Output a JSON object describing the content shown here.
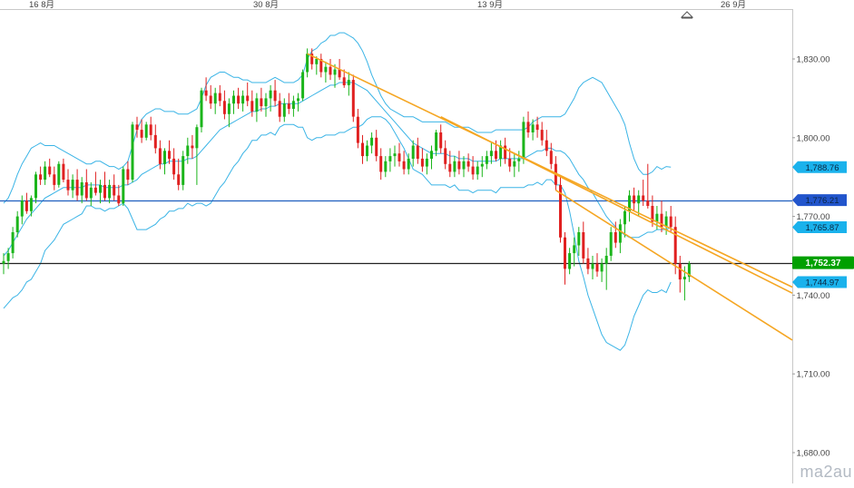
{
  "chart_data": {
    "type": "candlestick",
    "title": "",
    "x_ticks": [
      "16 8月",
      "30 8月",
      "13 9月",
      "26 9月"
    ],
    "y_ticks": [
      "1,830.00",
      "1,800.00",
      "1,770.00",
      "1,740.00",
      "1,710.00",
      "1,680.00"
    ],
    "ylim": [
      1675,
      1848
    ],
    "grid": false,
    "colors": {
      "up": "#1bb51b",
      "down": "#e02020",
      "bollinger": "#3ab4e6",
      "trendline": "#f5a623",
      "support": "#1f5fbf",
      "current": "#222222",
      "price_tag_up": "#00a000",
      "price_tag_band": "#1ab2ec",
      "price_tag_support": "#2255cc"
    },
    "price_tags": [
      {
        "name": "upper-band",
        "label": "1,788.76",
        "value": 1788.76
      },
      {
        "name": "support-level",
        "label": "1,776.21",
        "value": 1776.21
      },
      {
        "name": "middle-band",
        "label": "1,765.87",
        "value": 1765.87
      },
      {
        "name": "current-price",
        "label": "1,752.37",
        "value": 1752.37
      },
      {
        "name": "lower-band",
        "label": "1,744.97",
        "value": 1744.97
      }
    ],
    "horizontal_lines": [
      {
        "name": "support-line",
        "value": 1776.21
      },
      {
        "name": "current-price-line",
        "value": 1752.37
      }
    ],
    "trendlines": [
      {
        "name": "trendline-upper",
        "from_index": 66,
        "from_value": 1832,
        "to_index": 130,
        "to_value": 1778
      },
      {
        "name": "trendline-mid",
        "from_index": 95,
        "from_value": 1808,
        "to_index": 145,
        "to_value": 1764
      },
      {
        "name": "trendline-lower",
        "from_index": 120,
        "from_value": 1780,
        "to_index": 147,
        "to_value": 1750
      }
    ],
    "candles_ohlc": [
      [
        1752,
        1756,
        1748,
        1753
      ],
      [
        1753,
        1758,
        1750,
        1756
      ],
      [
        1756,
        1766,
        1754,
        1764
      ],
      [
        1764,
        1772,
        1762,
        1770
      ],
      [
        1770,
        1778,
        1767,
        1776
      ],
      [
        1776,
        1779,
        1771,
        1772
      ],
      [
        1772,
        1778,
        1770,
        1777
      ],
      [
        1777,
        1787,
        1775,
        1786
      ],
      [
        1786,
        1789,
        1782,
        1784
      ],
      [
        1784,
        1791,
        1782,
        1789
      ],
      [
        1789,
        1792,
        1785,
        1786
      ],
      [
        1786,
        1789,
        1780,
        1782
      ],
      [
        1782,
        1791,
        1781,
        1790
      ],
      [
        1790,
        1792,
        1783,
        1784
      ],
      [
        1784,
        1788,
        1778,
        1780
      ],
      [
        1780,
        1786,
        1777,
        1784
      ],
      [
        1784,
        1788,
        1776,
        1778
      ],
      [
        1778,
        1785,
        1775,
        1783
      ],
      [
        1783,
        1788,
        1776,
        1777
      ],
      [
        1777,
        1783,
        1774,
        1781
      ],
      [
        1781,
        1787,
        1778,
        1779
      ],
      [
        1779,
        1784,
        1775,
        1782
      ],
      [
        1782,
        1787,
        1776,
        1777
      ],
      [
        1777,
        1784,
        1775,
        1782
      ],
      [
        1782,
        1786,
        1776,
        1778
      ],
      [
        1778,
        1782,
        1774,
        1775
      ],
      [
        1775,
        1789,
        1774,
        1788
      ],
      [
        1788,
        1791,
        1782,
        1784
      ],
      [
        1784,
        1806,
        1783,
        1805
      ],
      [
        1805,
        1808,
        1800,
        1803
      ],
      [
        1803,
        1807,
        1798,
        1800
      ],
      [
        1800,
        1806,
        1799,
        1805
      ],
      [
        1805,
        1808,
        1799,
        1801
      ],
      [
        1801,
        1805,
        1794,
        1796
      ],
      [
        1796,
        1799,
        1788,
        1790
      ],
      [
        1790,
        1796,
        1786,
        1795
      ],
      [
        1795,
        1799,
        1790,
        1792
      ],
      [
        1792,
        1796,
        1784,
        1786
      ],
      [
        1786,
        1792,
        1780,
        1782
      ],
      [
        1782,
        1795,
        1780,
        1793
      ],
      [
        1793,
        1800,
        1790,
        1797
      ],
      [
        1797,
        1801,
        1792,
        1796
      ],
      [
        1796,
        1805,
        1782,
        1804
      ],
      [
        1804,
        1819,
        1802,
        1818
      ],
      [
        1818,
        1823,
        1814,
        1816
      ],
      [
        1816,
        1820,
        1811,
        1813
      ],
      [
        1813,
        1819,
        1809,
        1817
      ],
      [
        1817,
        1820,
        1812,
        1814
      ],
      [
        1814,
        1818,
        1807,
        1809
      ],
      [
        1809,
        1815,
        1804,
        1813
      ],
      [
        1813,
        1818,
        1809,
        1816
      ],
      [
        1816,
        1819,
        1811,
        1813
      ],
      [
        1813,
        1818,
        1810,
        1816
      ],
      [
        1816,
        1821,
        1812,
        1814
      ],
      [
        1814,
        1818,
        1808,
        1810
      ],
      [
        1810,
        1817,
        1806,
        1815
      ],
      [
        1815,
        1819,
        1810,
        1812
      ],
      [
        1812,
        1817,
        1808,
        1815
      ],
      [
        1815,
        1820,
        1810,
        1818
      ],
      [
        1818,
        1822,
        1812,
        1814
      ],
      [
        1814,
        1817,
        1806,
        1808
      ],
      [
        1808,
        1815,
        1806,
        1813
      ],
      [
        1813,
        1817,
        1809,
        1811
      ],
      [
        1811,
        1816,
        1808,
        1814
      ],
      [
        1814,
        1817,
        1810,
        1815
      ],
      [
        1815,
        1826,
        1814,
        1825
      ],
      [
        1825,
        1834,
        1823,
        1832
      ],
      [
        1832,
        1834,
        1826,
        1828
      ],
      [
        1828,
        1831,
        1824,
        1830
      ],
      [
        1830,
        1832,
        1823,
        1825
      ],
      [
        1825,
        1829,
        1821,
        1827
      ],
      [
        1827,
        1830,
        1822,
        1824
      ],
      [
        1824,
        1828,
        1819,
        1826
      ],
      [
        1826,
        1830,
        1822,
        1823
      ],
      [
        1823,
        1826,
        1819,
        1820
      ],
      [
        1820,
        1825,
        1816,
        1822
      ],
      [
        1822,
        1824,
        1806,
        1808
      ],
      [
        1808,
        1811,
        1796,
        1798
      ],
      [
        1798,
        1801,
        1790,
        1793
      ],
      [
        1793,
        1799,
        1791,
        1797
      ],
      [
        1797,
        1802,
        1794,
        1800
      ],
      [
        1800,
        1803,
        1791,
        1793
      ],
      [
        1793,
        1796,
        1784,
        1787
      ],
      [
        1787,
        1793,
        1785,
        1791
      ],
      [
        1791,
        1796,
        1787,
        1793
      ],
      [
        1793,
        1797,
        1789,
        1794
      ],
      [
        1794,
        1798,
        1789,
        1791
      ],
      [
        1791,
        1795,
        1786,
        1788
      ],
      [
        1788,
        1794,
        1786,
        1792
      ],
      [
        1792,
        1799,
        1789,
        1797
      ],
      [
        1797,
        1800,
        1790,
        1792
      ],
      [
        1792,
        1796,
        1787,
        1789
      ],
      [
        1789,
        1794,
        1786,
        1792
      ],
      [
        1792,
        1797,
        1788,
        1795
      ],
      [
        1795,
        1803,
        1793,
        1802
      ],
      [
        1802,
        1805,
        1794,
        1796
      ],
      [
        1796,
        1799,
        1788,
        1790
      ],
      [
        1790,
        1795,
        1785,
        1787
      ],
      [
        1787,
        1793,
        1785,
        1791
      ],
      [
        1791,
        1795,
        1786,
        1788
      ],
      [
        1788,
        1793,
        1785,
        1791
      ],
      [
        1791,
        1794,
        1787,
        1789
      ],
      [
        1789,
        1793,
        1784,
        1786
      ],
      [
        1786,
        1791,
        1784,
        1789
      ],
      [
        1789,
        1793,
        1785,
        1790
      ],
      [
        1790,
        1795,
        1788,
        1793
      ],
      [
        1793,
        1798,
        1790,
        1795
      ],
      [
        1795,
        1799,
        1791,
        1792
      ],
      [
        1792,
        1799,
        1789,
        1797
      ],
      [
        1797,
        1800,
        1790,
        1792
      ],
      [
        1792,
        1796,
        1787,
        1789
      ],
      [
        1789,
        1794,
        1785,
        1791
      ],
      [
        1791,
        1795,
        1787,
        1792
      ],
      [
        1792,
        1808,
        1790,
        1806
      ],
      [
        1806,
        1810,
        1800,
        1802
      ],
      [
        1802,
        1807,
        1799,
        1805
      ],
      [
        1805,
        1808,
        1800,
        1803
      ],
      [
        1803,
        1806,
        1797,
        1799
      ],
      [
        1799,
        1803,
        1793,
        1795
      ],
      [
        1795,
        1798,
        1788,
        1790
      ],
      [
        1790,
        1793,
        1780,
        1782
      ],
      [
        1782,
        1785,
        1760,
        1762
      ],
      [
        1762,
        1764,
        1744,
        1750
      ],
      [
        1750,
        1758,
        1748,
        1756
      ],
      [
        1756,
        1762,
        1751,
        1759
      ],
      [
        1759,
        1766,
        1755,
        1764
      ],
      [
        1764,
        1768,
        1752,
        1754
      ],
      [
        1754,
        1758,
        1748,
        1750
      ],
      [
        1750,
        1755,
        1746,
        1752
      ],
      [
        1752,
        1756,
        1747,
        1749
      ],
      [
        1749,
        1754,
        1745,
        1752
      ],
      [
        1752,
        1758,
        1742,
        1755
      ],
      [
        1755,
        1766,
        1753,
        1764
      ],
      [
        1764,
        1768,
        1758,
        1760
      ],
      [
        1760,
        1769,
        1756,
        1767
      ],
      [
        1767,
        1774,
        1762,
        1772
      ],
      [
        1772,
        1780,
        1768,
        1778
      ],
      [
        1778,
        1781,
        1772,
        1775
      ],
      [
        1775,
        1780,
        1770,
        1778
      ],
      [
        1778,
        1784,
        1774,
        1776
      ],
      [
        1776,
        1790,
        1773,
        1774
      ],
      [
        1774,
        1778,
        1766,
        1768
      ],
      [
        1768,
        1774,
        1765,
        1771
      ],
      [
        1771,
        1776,
        1764,
        1766
      ],
      [
        1766,
        1772,
        1763,
        1770
      ],
      [
        1770,
        1774,
        1764,
        1766
      ],
      [
        1766,
        1770,
        1748,
        1752
      ],
      [
        1752,
        1755,
        1741,
        1746
      ],
      [
        1746,
        1751,
        1738,
        1747
      ],
      [
        1747,
        1753,
        1745,
        1752
      ]
    ],
    "bollinger_bands": {
      "upper": [
        1775,
        1777,
        1781,
        1786,
        1790,
        1793,
        1796,
        1797,
        1798,
        1797,
        1797,
        1797,
        1796,
        1795,
        1794,
        1793,
        1792,
        1791,
        1790,
        1790,
        1791,
        1791,
        1790,
        1789,
        1789,
        1788,
        1789,
        1791,
        1797,
        1803,
        1807,
        1809,
        1810,
        1811,
        1811,
        1810,
        1810,
        1810,
        1809,
        1809,
        1809,
        1810,
        1811,
        1815,
        1820,
        1823,
        1824,
        1825,
        1825,
        1824,
        1823,
        1823,
        1822,
        1822,
        1821,
        1821,
        1821,
        1821,
        1822,
        1823,
        1822,
        1821,
        1821,
        1821,
        1822,
        1824,
        1830,
        1833,
        1834,
        1836,
        1837,
        1839,
        1839,
        1840,
        1840,
        1839,
        1838,
        1836,
        1833,
        1829,
        1824,
        1820,
        1816,
        1813,
        1811,
        1810,
        1809,
        1808,
        1808,
        1808,
        1807,
        1806,
        1806,
        1806,
        1806,
        1806,
        1806,
        1805,
        1804,
        1804,
        1804,
        1804,
        1803,
        1802,
        1802,
        1802,
        1802,
        1803,
        1803,
        1803,
        1803,
        1803,
        1803,
        1803,
        1804,
        1806,
        1807,
        1808,
        1808,
        1808,
        1808,
        1808,
        1809,
        1812,
        1815,
        1819,
        1821,
        1822,
        1823,
        1822,
        1821,
        1818,
        1815,
        1812,
        1809,
        1805,
        1798,
        1792,
        1788,
        1786,
        1786,
        1787,
        1789,
        1788,
        1789,
        1788.76
      ],
      "middle": [
        1755,
        1757,
        1760,
        1763,
        1766,
        1769,
        1771,
        1773,
        1775,
        1777,
        1778,
        1779,
        1780,
        1781,
        1781,
        1781,
        1781,
        1781,
        1782,
        1782,
        1782,
        1782,
        1781,
        1781,
        1781,
        1781,
        1782,
        1782,
        1783,
        1784,
        1786,
        1787,
        1788,
        1789,
        1790,
        1790,
        1791,
        1791,
        1791,
        1791,
        1792,
        1792,
        1793,
        1795,
        1797,
        1799,
        1801,
        1803,
        1804,
        1805,
        1806,
        1807,
        1808,
        1809,
        1810,
        1810,
        1811,
        1811,
        1812,
        1812,
        1813,
        1813,
        1813,
        1813,
        1813,
        1814,
        1815,
        1816,
        1817,
        1818,
        1819,
        1820,
        1820,
        1821,
        1821,
        1821,
        1821,
        1820,
        1819,
        1818,
        1816,
        1814,
        1812,
        1810,
        1808,
        1806,
        1804,
        1802,
        1800,
        1798,
        1797,
        1796,
        1795,
        1794,
        1794,
        1794,
        1794,
        1793,
        1793,
        1792,
        1792,
        1792,
        1791,
        1791,
        1791,
        1791,
        1791,
        1791,
        1792,
        1792,
        1792,
        1792,
        1792,
        1792,
        1793,
        1794,
        1795,
        1795,
        1796,
        1796,
        1795,
        1795,
        1794,
        1792,
        1789,
        1786,
        1784,
        1781,
        1779,
        1776,
        1773,
        1770,
        1768,
        1766,
        1764,
        1763,
        1762,
        1762,
        1762,
        1763,
        1764,
        1764,
        1765,
        1765,
        1765,
        1765.87
      ],
      "lower": [
        1735,
        1737,
        1739,
        1740,
        1742,
        1745,
        1746,
        1749,
        1752,
        1757,
        1759,
        1761,
        1764,
        1767,
        1768,
        1769,
        1770,
        1771,
        1774,
        1774,
        1773,
        1773,
        1772,
        1773,
        1773,
        1774,
        1775,
        1773,
        1769,
        1765,
        1765,
        1765,
        1766,
        1767,
        1769,
        1770,
        1772,
        1772,
        1773,
        1773,
        1775,
        1774,
        1775,
        1775,
        1774,
        1775,
        1778,
        1781,
        1783,
        1786,
        1789,
        1791,
        1794,
        1796,
        1799,
        1799,
        1801,
        1801,
        1802,
        1801,
        1804,
        1805,
        1805,
        1805,
        1804,
        1804,
        1800,
        1799,
        1800,
        1800,
        1801,
        1801,
        1801,
        1802,
        1802,
        1803,
        1804,
        1804,
        1805,
        1807,
        1808,
        1808,
        1808,
        1807,
        1805,
        1802,
        1799,
        1796,
        1792,
        1788,
        1787,
        1786,
        1784,
        1782,
        1782,
        1782,
        1782,
        1781,
        1782,
        1780,
        1780,
        1780,
        1779,
        1780,
        1780,
        1780,
        1780,
        1779,
        1781,
        1781,
        1781,
        1781,
        1781,
        1781,
        1782,
        1782,
        1783,
        1782,
        1784,
        1784,
        1782,
        1782,
        1779,
        1772,
        1763,
        1753,
        1747,
        1740,
        1735,
        1730,
        1725,
        1722,
        1721,
        1720,
        1719,
        1721,
        1726,
        1732,
        1736,
        1740,
        1742,
        1741,
        1741,
        1742,
        1741,
        1744.97
      ]
    }
  }
}
